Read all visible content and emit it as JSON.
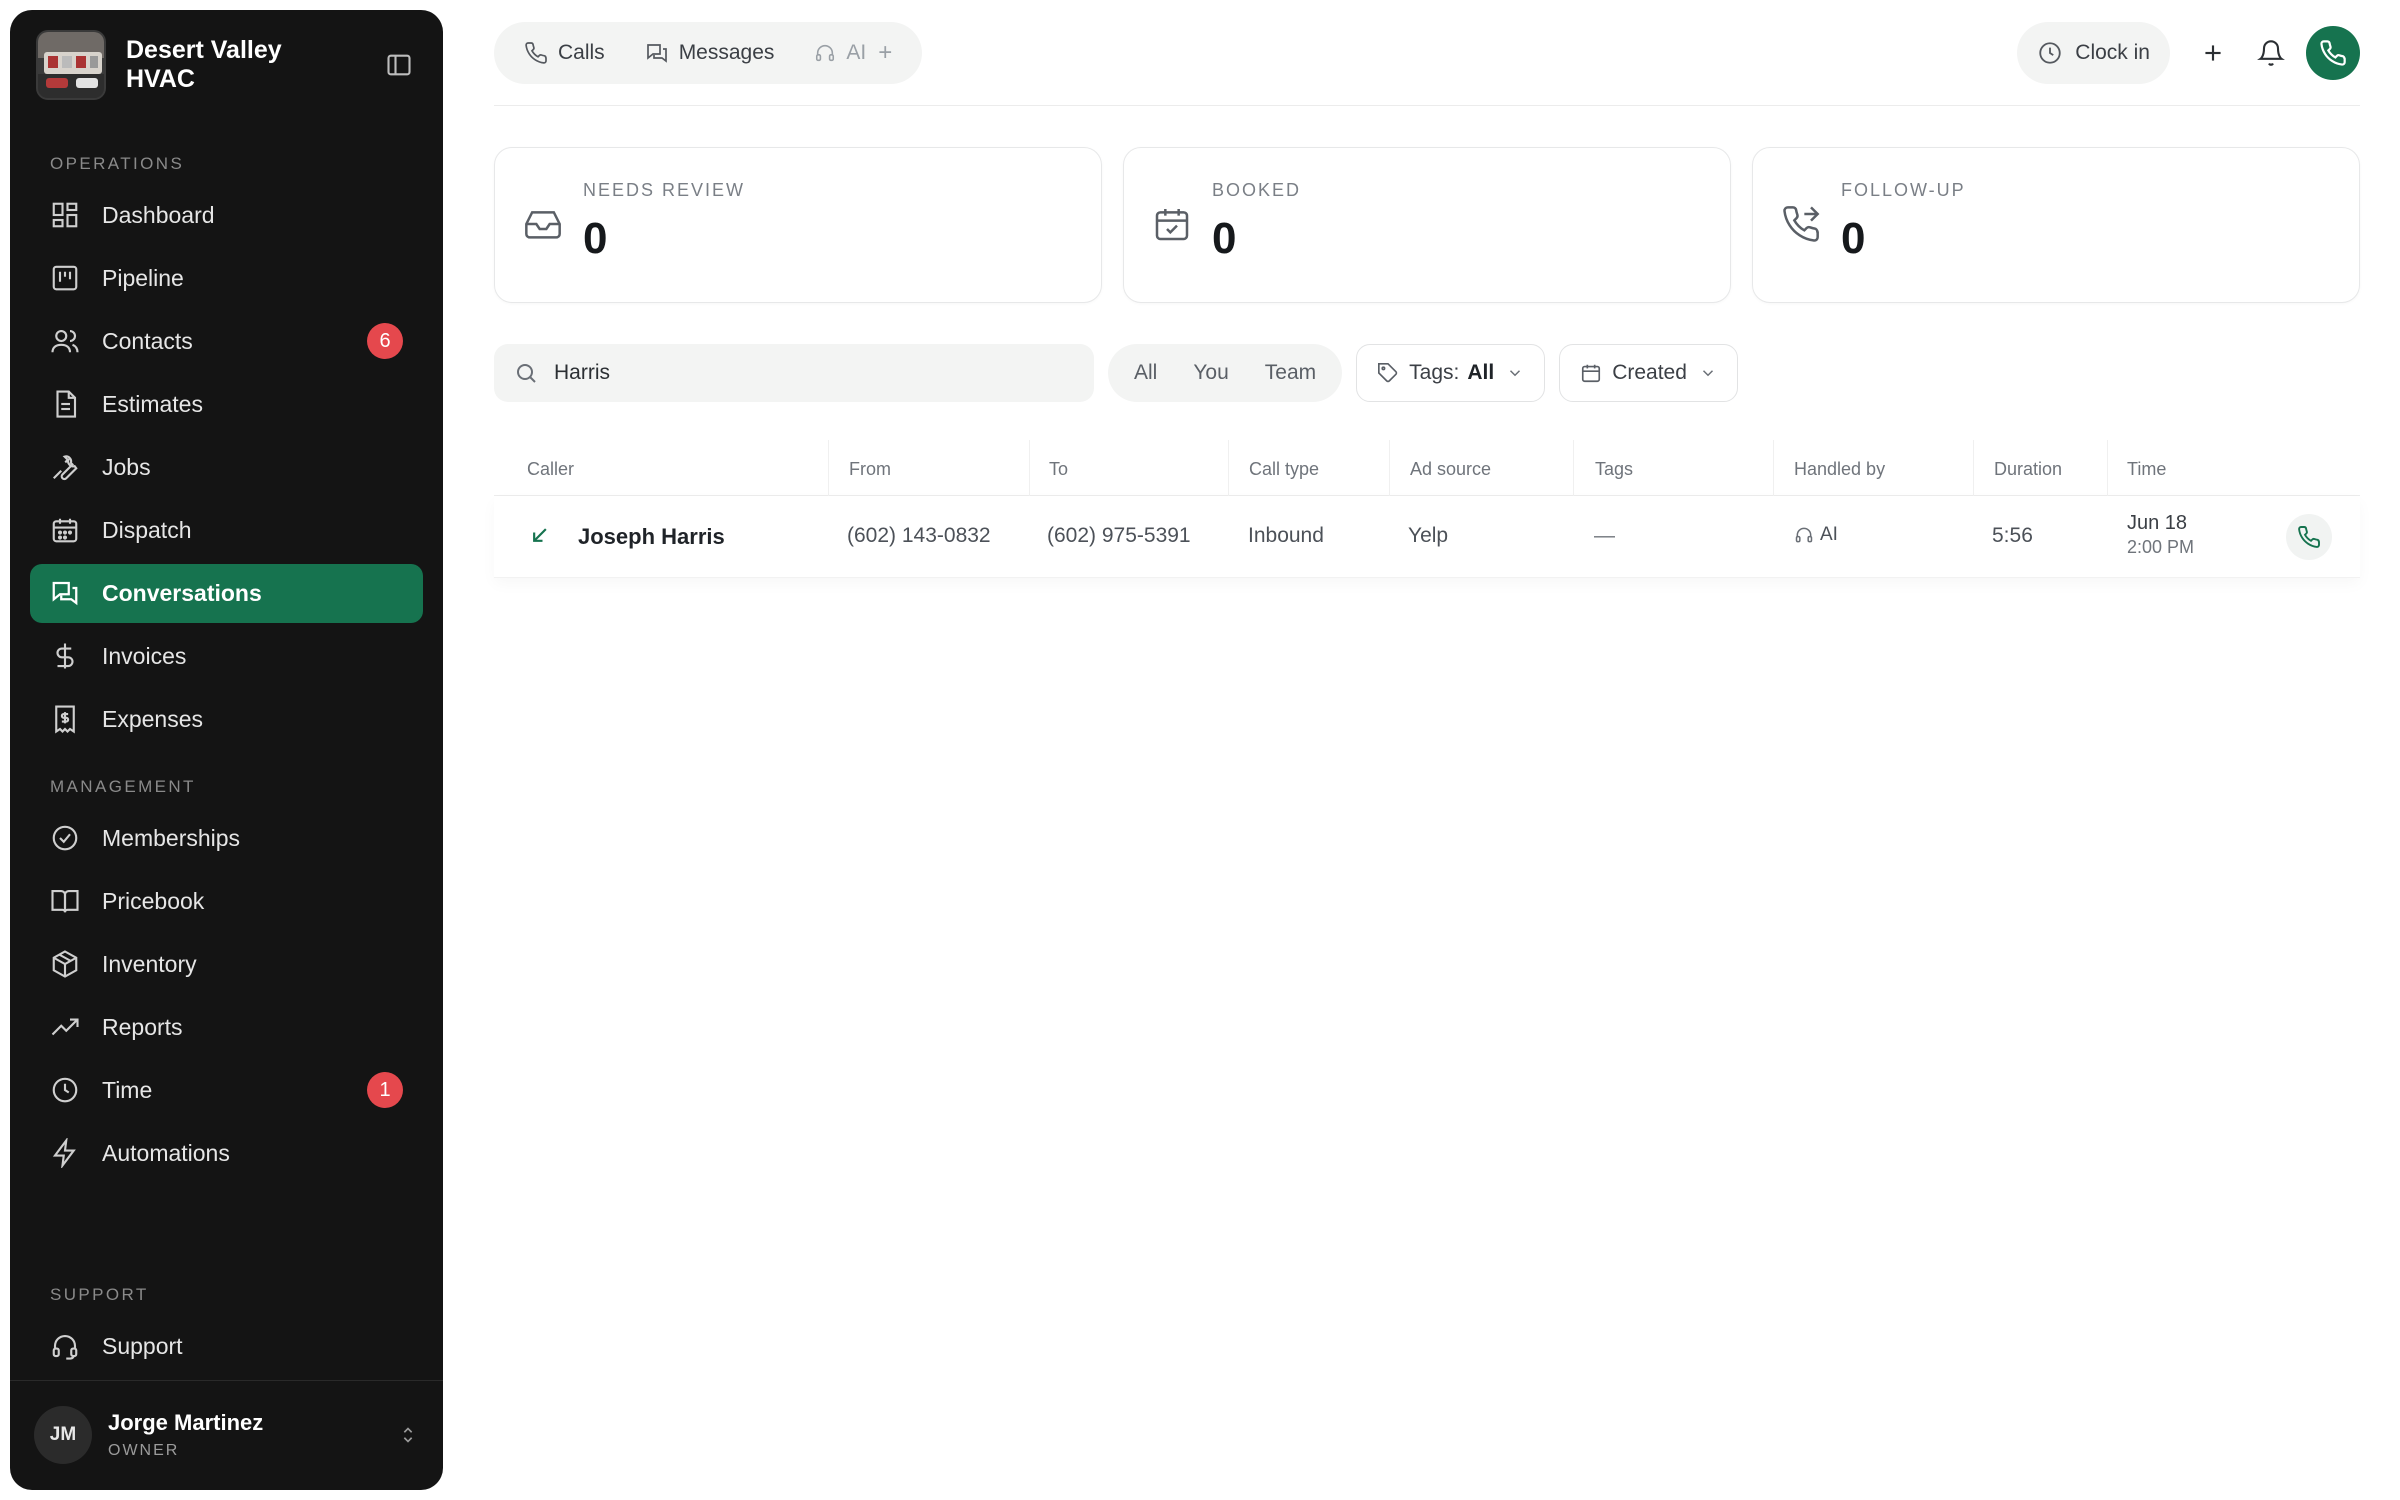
{
  "brand": {
    "name": "Desert Valley HVAC"
  },
  "sidebar": {
    "sections": {
      "operations": "OPERATIONS",
      "management": "MANAGEMENT",
      "support": "SUPPORT"
    },
    "operations": [
      {
        "label": "Dashboard",
        "icon": "dashboard-icon"
      },
      {
        "label": "Pipeline",
        "icon": "pipeline-icon"
      },
      {
        "label": "Contacts",
        "icon": "contacts-icon",
        "badge": "6"
      },
      {
        "label": "Estimates",
        "icon": "estimates-icon"
      },
      {
        "label": "Jobs",
        "icon": "wrench-icon"
      },
      {
        "label": "Dispatch",
        "icon": "calendar-icon"
      },
      {
        "label": "Conversations",
        "icon": "conversations-icon",
        "active": true
      },
      {
        "label": "Invoices",
        "icon": "dollar-icon"
      },
      {
        "label": "Expenses",
        "icon": "receipt-icon"
      }
    ],
    "management": [
      {
        "label": "Memberships",
        "icon": "badge-check-icon"
      },
      {
        "label": "Pricebook",
        "icon": "book-icon"
      },
      {
        "label": "Inventory",
        "icon": "box-icon"
      },
      {
        "label": "Reports",
        "icon": "trend-icon"
      },
      {
        "label": "Time",
        "icon": "clock-icon",
        "badge": "1"
      },
      {
        "label": "Automations",
        "icon": "bolt-icon"
      }
    ],
    "support": [
      {
        "label": "Support",
        "icon": "headset-icon"
      }
    ],
    "user": {
      "initials": "JM",
      "name": "Jorge Martinez",
      "role": "OWNER"
    }
  },
  "topbar": {
    "tabs": [
      {
        "label": "Calls",
        "icon": "phone-icon"
      },
      {
        "label": "Messages",
        "icon": "messages-icon"
      },
      {
        "label": "AI",
        "icon": "headset-icon",
        "muted": true
      }
    ],
    "clock_in": "Clock in"
  },
  "stats": [
    {
      "label": "NEEDS REVIEW",
      "value": "0",
      "icon": "inbox-icon"
    },
    {
      "label": "BOOKED",
      "value": "0",
      "icon": "calendar-check-icon"
    },
    {
      "label": "FOLLOW-UP",
      "value": "0",
      "icon": "phone-forward-icon"
    }
  ],
  "filters": {
    "search_value": "Harris",
    "segments": [
      "All",
      "You",
      "Team"
    ],
    "tags_label": "Tags:",
    "tags_value": "All",
    "sort_label": "Created"
  },
  "table": {
    "headers": [
      "Caller",
      "From",
      "To",
      "Call type",
      "Ad source",
      "Tags",
      "Handled by",
      "Duration",
      "Time"
    ],
    "rows": [
      {
        "caller": "Joseph Harris",
        "from": "(602) 143-0832",
        "to": "(602) 975-5391",
        "call_type": "Inbound",
        "ad_source": "Yelp",
        "tags": "—",
        "handled_by": "AI",
        "duration": "5:56",
        "date": "Jun 18",
        "time": "2:00 PM"
      }
    ]
  },
  "colors": {
    "accent": "#16734f",
    "badge": "#e5484d",
    "sidebar_bg": "#141414"
  }
}
